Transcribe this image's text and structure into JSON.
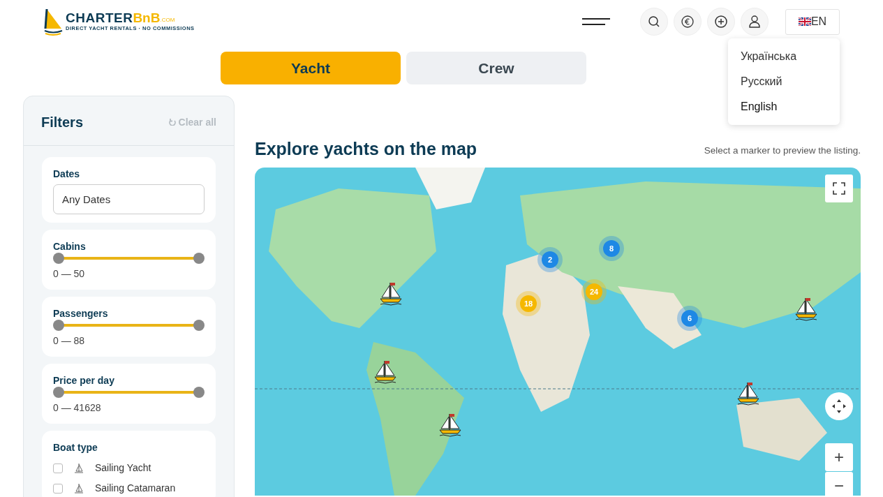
{
  "header": {
    "logo": {
      "name": "CHARTER",
      "accent": "BnB",
      "domain": ".COM",
      "tagline": "DIRECT YACHT RENTALS · NO COMMISSIONS"
    },
    "language": {
      "label": "EN",
      "expanded": true,
      "options": [
        {
          "label": "Українська",
          "selected": false
        },
        {
          "label": "Русский",
          "selected": false
        },
        {
          "label": "English",
          "selected": true
        }
      ]
    }
  },
  "tabs": [
    {
      "label": "Yacht",
      "selected": true
    },
    {
      "label": "Crew",
      "selected": false
    }
  ],
  "filters": {
    "title": "Filters",
    "clear": "Clear all",
    "sections": [
      {
        "kind": "date",
        "label": "Dates",
        "placeholder": "Any Dates"
      },
      {
        "kind": "range",
        "label": "Cabins",
        "reading": "0 — 50",
        "thumbs": [
          {
            "level": 0
          },
          {
            "level": 1
          }
        ]
      },
      {
        "kind": "range",
        "label": "Passengers",
        "reading": "0 — 88",
        "thumbs": [
          {
            "level": 0
          },
          {
            "level": 1
          }
        ]
      },
      {
        "kind": "range",
        "label": "Price per day",
        "reading": "0 — 41628",
        "thumbs": [
          {
            "level": 0
          },
          {
            "level": 1
          }
        ]
      },
      {
        "kind": "checklist",
        "label": "Boat type",
        "options": [
          {
            "label": "Sailing Yacht",
            "checked": false
          },
          {
            "label": "Sailing Catamaran",
            "checked": false
          }
        ]
      }
    ]
  },
  "map": {
    "title": "Explore yachts on the map",
    "hint": "Select a marker to preview the listing.",
    "markers": [
      {
        "kind": "cluster",
        "count": "2",
        "color": "#1e88e5"
      },
      {
        "kind": "cluster",
        "count": "8",
        "color": "#1e88e5"
      },
      {
        "kind": "cluster",
        "count": "24",
        "color": "#f5b800"
      },
      {
        "kind": "cluster",
        "count": "18",
        "color": "#f5b800"
      },
      {
        "kind": "cluster",
        "count": "6",
        "color": "#1e88e5"
      },
      {
        "kind": "yacht"
      },
      {
        "kind": "yacht"
      },
      {
        "kind": "yacht"
      },
      {
        "kind": "yacht"
      },
      {
        "kind": "yacht"
      }
    ],
    "controls": [
      {
        "kind": "fullscreen"
      },
      {
        "kind": "recenter"
      },
      {
        "kind": "zoom-in",
        "label": "+"
      },
      {
        "kind": "zoom-out",
        "label": "−"
      }
    ]
  }
}
